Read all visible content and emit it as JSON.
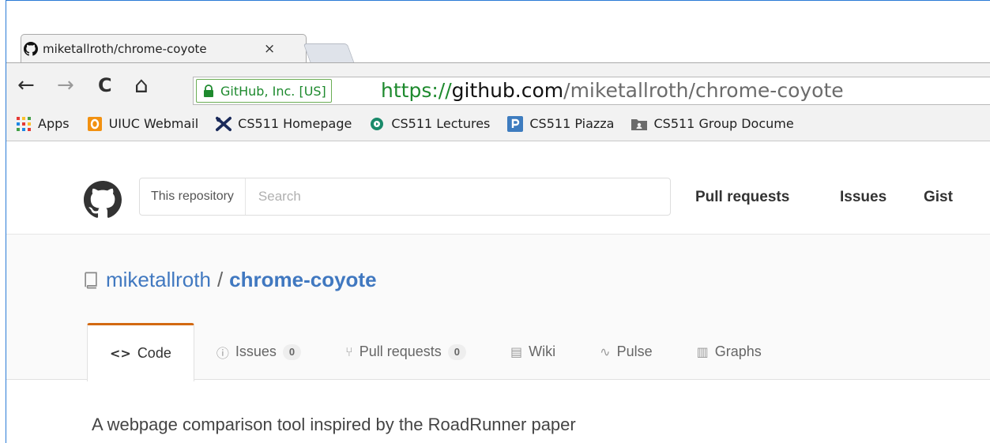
{
  "browser": {
    "tab_title": "miketallroth/chrome-coyote",
    "close_glyph": "×",
    "secure_label": "GitHub, Inc. [US]",
    "url_scheme": "https://",
    "url_host": "github.com",
    "url_path": "/miketallroth/chrome-coyote",
    "nav": {
      "back": "←",
      "forward": "→",
      "reload": "C",
      "home": "⌂"
    },
    "bookmarks": [
      {
        "label": "Apps",
        "icon": "apps-grid-icon"
      },
      {
        "label": "UIUC Webmail",
        "icon": "office-icon"
      },
      {
        "label": "CS511 Homepage",
        "icon": "cross-tools-icon"
      },
      {
        "label": "CS511 Lectures",
        "icon": "play-circle-icon"
      },
      {
        "label": "CS511 Piazza",
        "icon": "piazza-icon"
      },
      {
        "label": "CS511 Group Docume",
        "icon": "folder-icon"
      }
    ]
  },
  "github": {
    "search_scope": "This repository",
    "search_placeholder": "Search",
    "nav": [
      "Pull requests",
      "Issues",
      "Gist"
    ]
  },
  "repo": {
    "owner": "miketallroth",
    "separator": "/",
    "name": "chrome-coyote",
    "tabs": [
      {
        "label": "Code",
        "icon": "<>",
        "selected": true
      },
      {
        "label": "Issues",
        "icon": "ⓘ",
        "count": "0"
      },
      {
        "label": "Pull requests",
        "icon": "⑂",
        "count": "0"
      },
      {
        "label": "Wiki",
        "icon": "▤"
      },
      {
        "label": "Pulse",
        "icon": "∿"
      },
      {
        "label": "Graphs",
        "icon": "▥"
      }
    ],
    "description": "A webpage comparison tool inspired by the RoadRunner paper"
  },
  "colors": {
    "accent_tab": "#d26911",
    "link": "#4078c0",
    "secure_green": "#1e8a2e"
  }
}
